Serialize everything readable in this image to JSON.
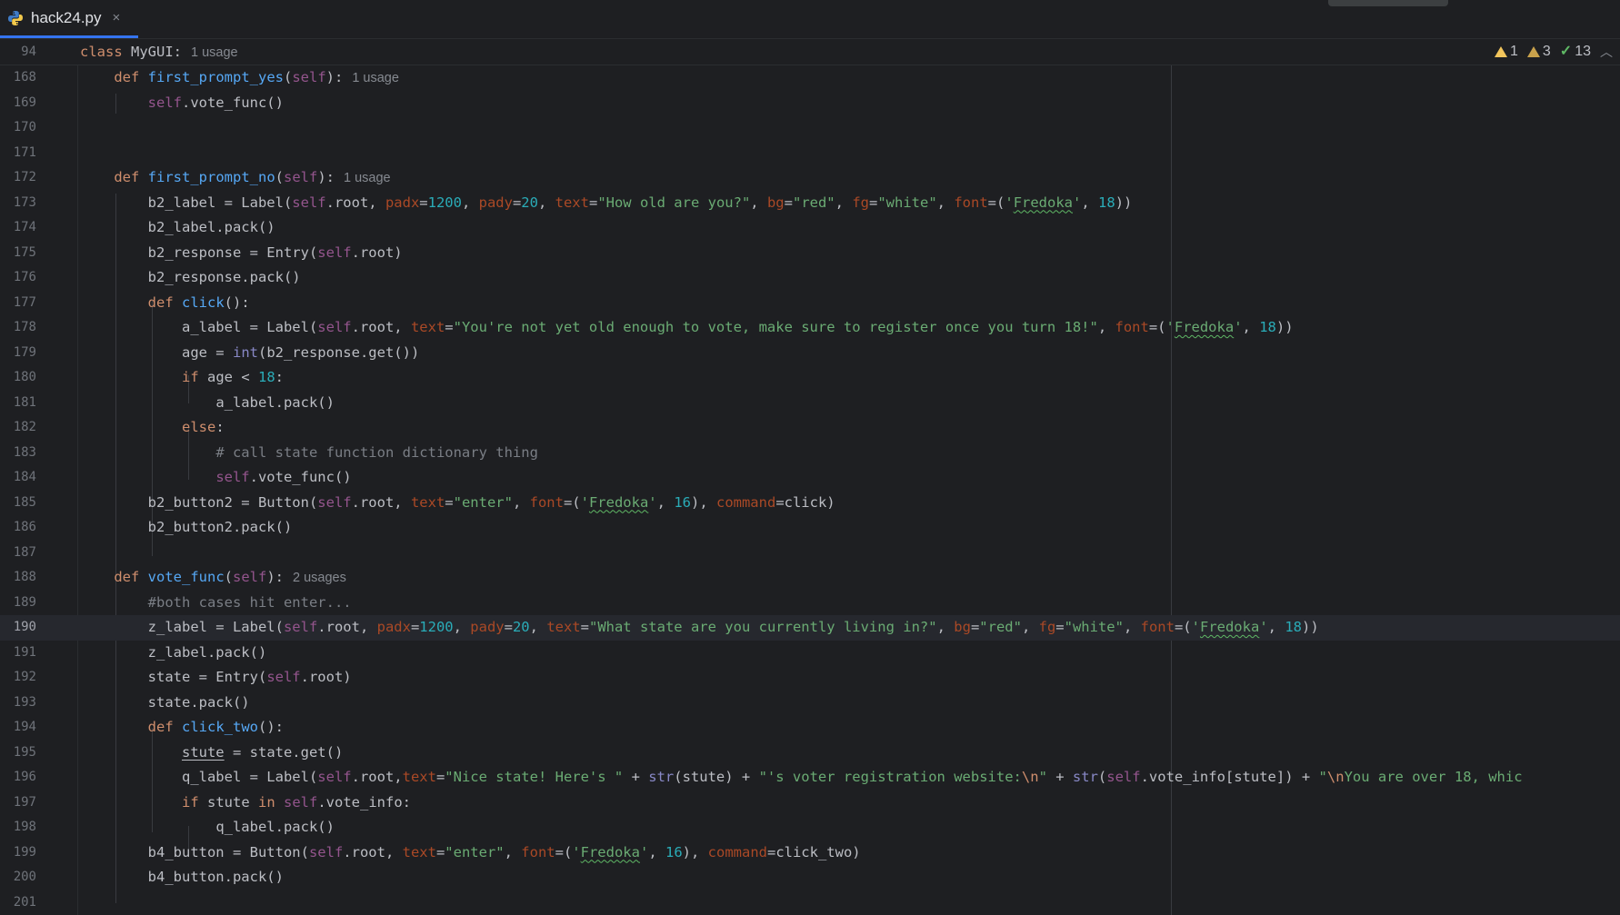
{
  "tab": {
    "filename": "hack24.py",
    "close_glyph": "×"
  },
  "sticky": {
    "line_number": "94",
    "class_kw": "class",
    "class_name": "MyGUI:",
    "usage_hint": "1 usage"
  },
  "inspections": {
    "errors": "1",
    "warnings": "3",
    "ok": "13"
  },
  "lines": [
    {
      "n": "168"
    },
    {
      "n": "169"
    },
    {
      "n": "170"
    },
    {
      "n": "171"
    },
    {
      "n": "172"
    },
    {
      "n": "173"
    },
    {
      "n": "174"
    },
    {
      "n": "175"
    },
    {
      "n": "176"
    },
    {
      "n": "177"
    },
    {
      "n": "178"
    },
    {
      "n": "179"
    },
    {
      "n": "180"
    },
    {
      "n": "181"
    },
    {
      "n": "182"
    },
    {
      "n": "183"
    },
    {
      "n": "184"
    },
    {
      "n": "185"
    },
    {
      "n": "186"
    },
    {
      "n": "187"
    },
    {
      "n": "188"
    },
    {
      "n": "189"
    },
    {
      "n": "190"
    },
    {
      "n": "191"
    },
    {
      "n": "192"
    },
    {
      "n": "193"
    },
    {
      "n": "194"
    },
    {
      "n": "195"
    },
    {
      "n": "196"
    },
    {
      "n": "197"
    },
    {
      "n": "198"
    },
    {
      "n": "199"
    },
    {
      "n": "200"
    },
    {
      "n": "201"
    }
  ],
  "code": {
    "l168_def": "def",
    "l168_name": "first_prompt_yes",
    "l168_hint": "1 usage",
    "l169": "self.vote_func()",
    "l172_def": "def",
    "l172_name": "first_prompt_no",
    "l172_hint": "1 usage",
    "l173_str1": "\"How old are you?\"",
    "l173_str2": "\"red\"",
    "l173_str3": "\"white\"",
    "l173_font": "Fredoka",
    "l173_pad1": "1200",
    "l173_pad2": "20",
    "l173_size": "18",
    "l174": "b2_label.pack()",
    "l176": "b2_response.pack()",
    "l177_name": "click",
    "l178_str": "\"You're not yet old enough to vote, make sure to register once you turn 18!\"",
    "l178_font": "Fredoka",
    "l178_size": "18",
    "l180_val": "18",
    "l181": "a_label.pack()",
    "l182": "else",
    "l183": "# call state function dictionary thing",
    "l185_str": "\"enter\"",
    "l185_font": "Fredoka",
    "l185_size": "16",
    "l186": "b2_button2.pack()",
    "l188_def": "def",
    "l188_name": "vote_func",
    "l188_hint": "2 usages",
    "l189": "#both cases hit enter...",
    "l190_str1": "\"What state are you currently living in?\"",
    "l190_str2": "\"red\"",
    "l190_str3": "\"white\"",
    "l190_font": "Fredoka",
    "l190_pad1": "1200",
    "l190_pad2": "20",
    "l190_size": "18",
    "l191": "z_label.pack()",
    "l193": "state.pack()",
    "l194_name": "click_two",
    "l196_str1": "\"Nice state! Here's \"",
    "l196_str2": "\"'s voter registration website:",
    "l196_esc1": "\\n",
    "l196_str3": "\"",
    "l196_esc2": "\\n",
    "l196_str4": "You are over 18, whic",
    "l198": "q_label.pack()",
    "l199_str": "\"enter\"",
    "l199_font": "Fredoka",
    "l199_size": "16",
    "l200": "b4_button.pack()"
  }
}
